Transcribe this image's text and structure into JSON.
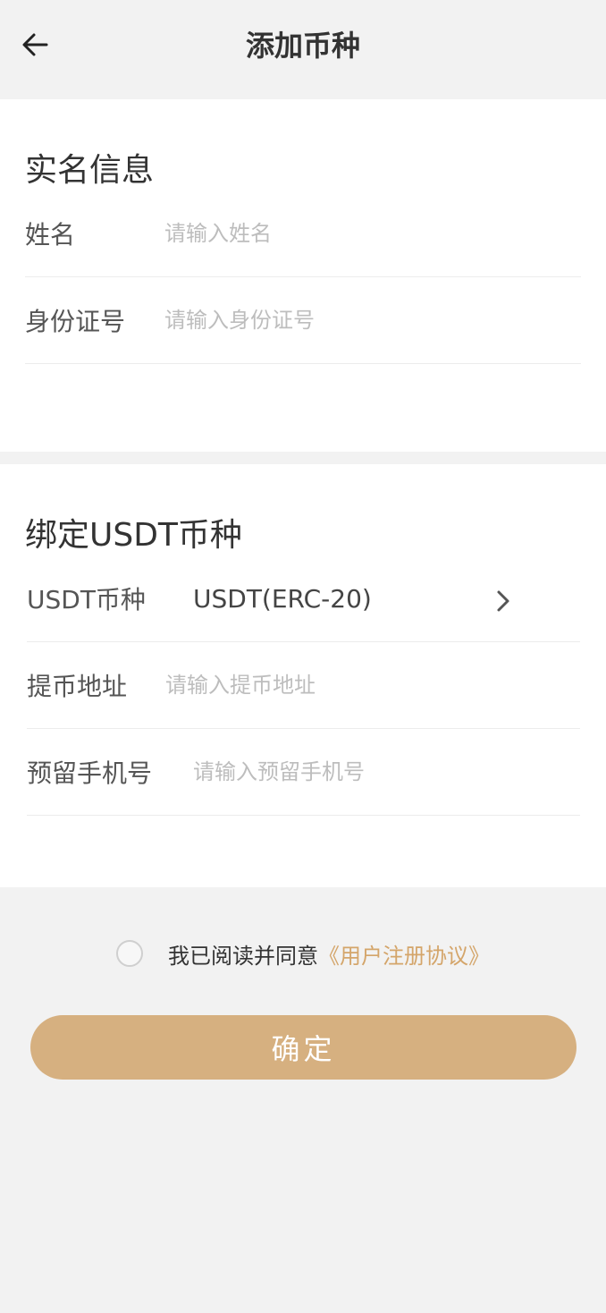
{
  "header": {
    "title": "添加币种",
    "back_icon": "arrow-left-icon"
  },
  "realname": {
    "title": "实名信息",
    "name_label": "姓名",
    "name_placeholder": "请输入姓名",
    "id_label": "身份证号",
    "id_placeholder": "请输入身份证号"
  },
  "bind": {
    "title": "绑定USDT币种",
    "currency_label": "USDT币种",
    "currency_value": "USDT(ERC-20)",
    "chevron_icon": "chevron-right-icon",
    "address_label": "提币地址",
    "address_placeholder": "请输入提币地址",
    "phone_label": "预留手机号",
    "phone_placeholder": "请输入预留手机号"
  },
  "agreement": {
    "text": "我已阅读并同意",
    "link": "《用户注册协议》",
    "checked": false
  },
  "confirm_label": "确定",
  "colors": {
    "accent": "#d6b080",
    "link": "#d4a56a",
    "background": "#f2f2f2"
  }
}
